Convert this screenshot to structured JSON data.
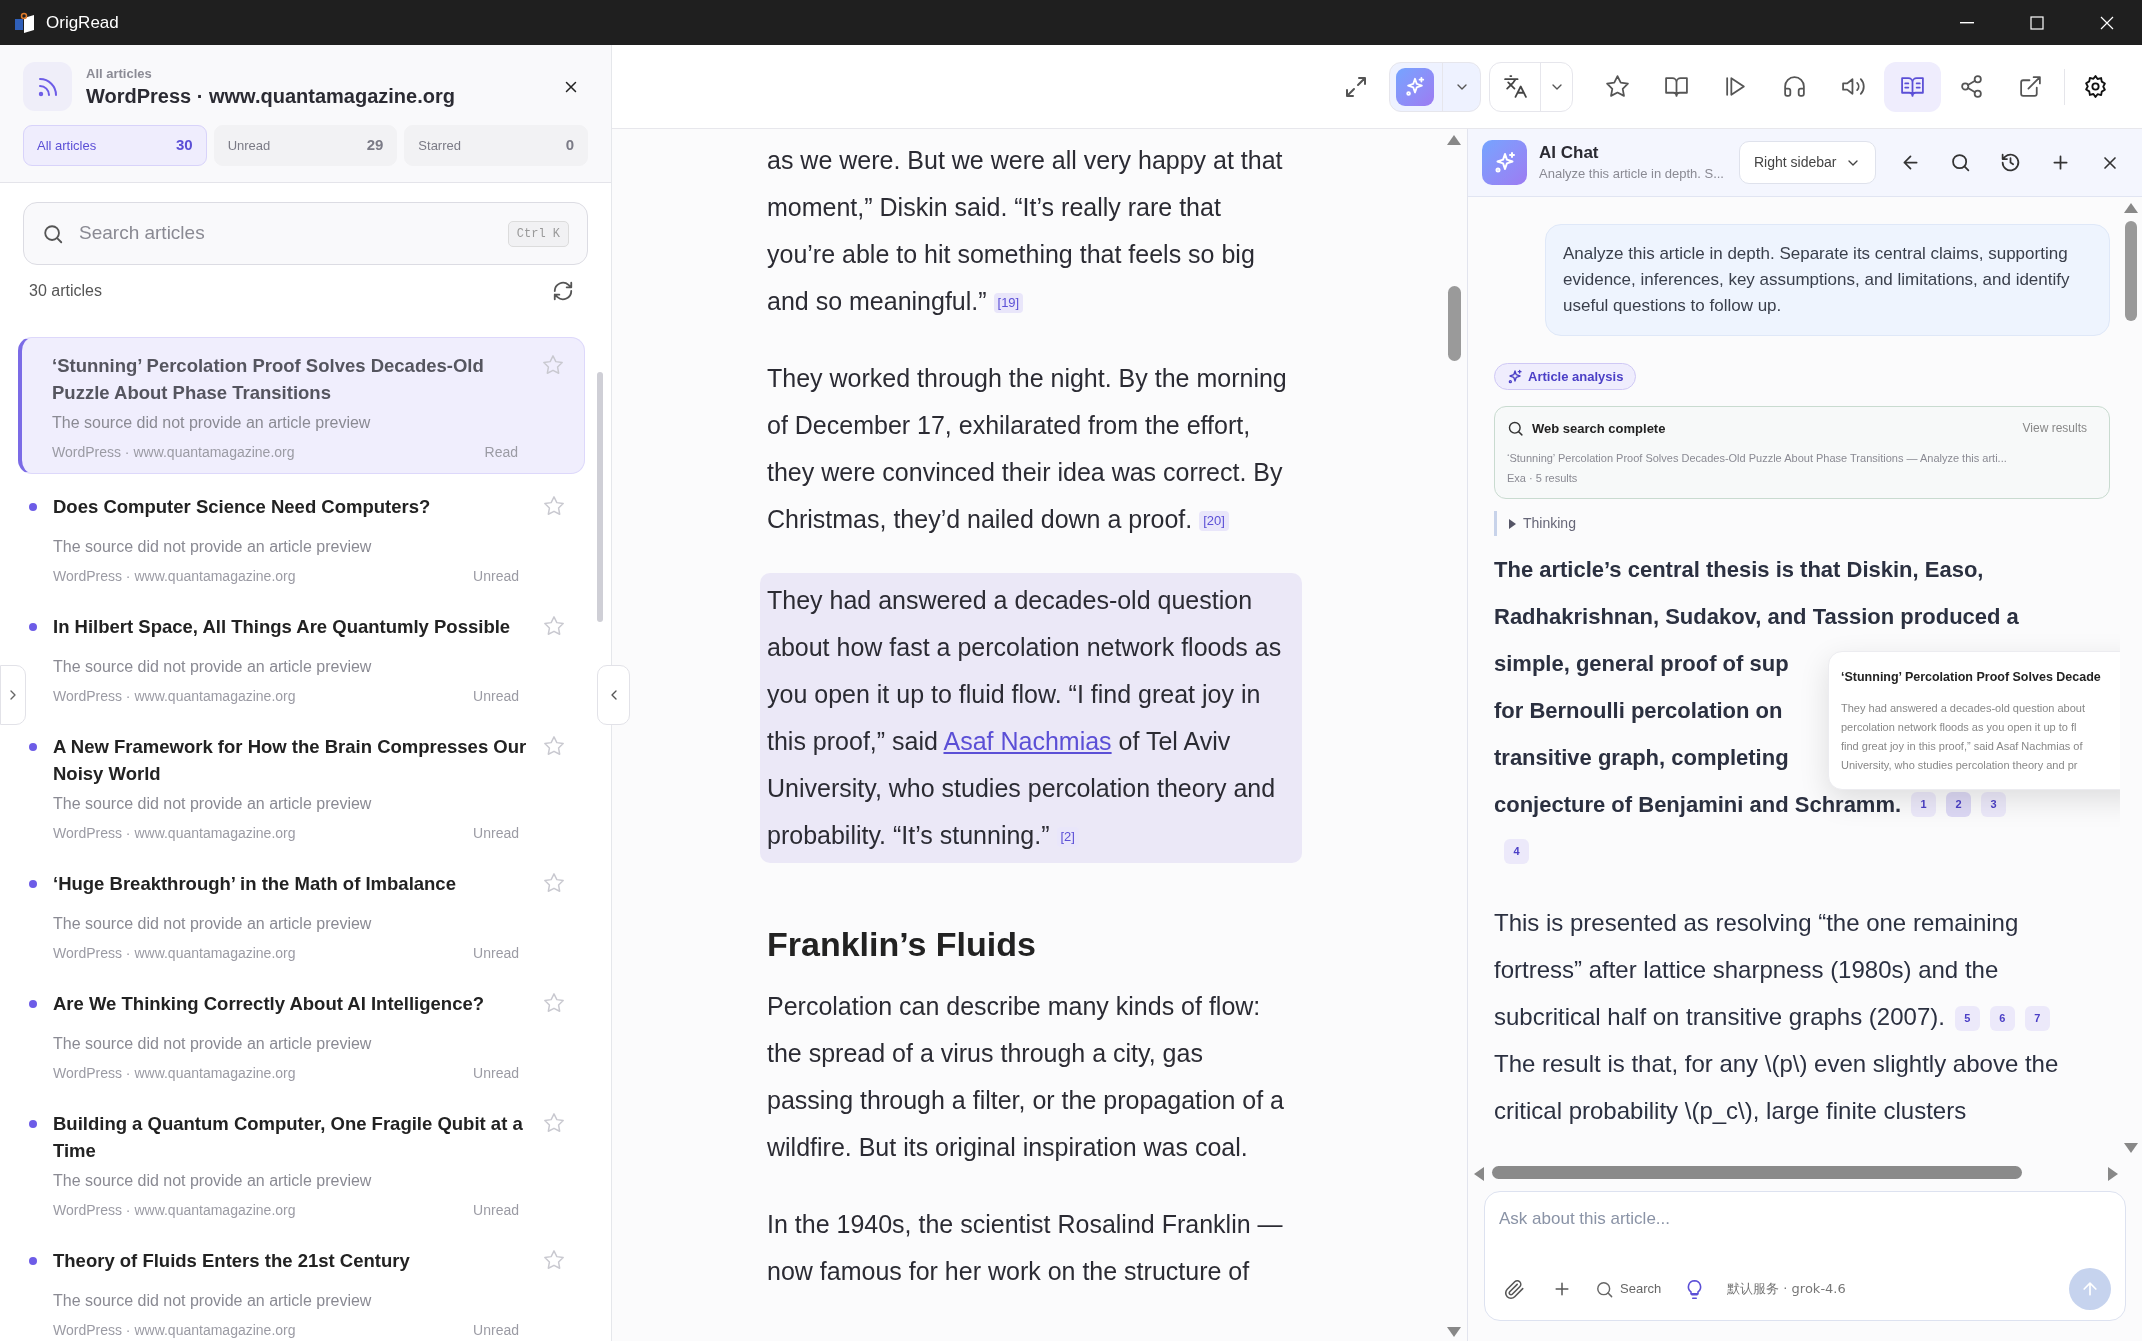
{
  "window": {
    "title": "OrigRead"
  },
  "sidebar": {
    "eyebrow": "All articles",
    "title": "WordPress · www.quantamagazine.org",
    "tabs": [
      {
        "label": "All articles",
        "count": "30",
        "selected": true
      },
      {
        "label": "Unread",
        "count": "29",
        "selected": false
      },
      {
        "label": "Starred",
        "count": "0",
        "selected": false
      }
    ],
    "search": {
      "placeholder": "Search articles",
      "shortcut": "Ctrl K"
    },
    "count_label": "30 articles",
    "articles": [
      {
        "title": "‘Stunning’ Percolation Proof Solves Decades-Old Puzzle About Phase Transitions",
        "preview": "The source did not provide an article preview",
        "source": "WordPress · www.quantamagazine.org",
        "status": "Read",
        "unread": false,
        "selected": true
      },
      {
        "title": "Does Computer Science Need Computers?",
        "preview": "The source did not provide an article preview",
        "source": "WordPress · www.quantamagazine.org",
        "status": "Unread",
        "unread": true,
        "selected": false
      },
      {
        "title": "In Hilbert Space, All Things Are Quantumly Possible",
        "preview": "The source did not provide an article preview",
        "source": "WordPress · www.quantamagazine.org",
        "status": "Unread",
        "unread": true,
        "selected": false
      },
      {
        "title": "A New Framework for How the Brain Compresses Our Noisy World",
        "preview": "The source did not provide an article preview",
        "source": "WordPress · www.quantamagazine.org",
        "status": "Unread",
        "unread": true,
        "selected": false
      },
      {
        "title": "‘Huge Breakthrough’ in the Math of Imbalance",
        "preview": "The source did not provide an article preview",
        "source": "WordPress · www.quantamagazine.org",
        "status": "Unread",
        "unread": true,
        "selected": false
      },
      {
        "title": "Are We Thinking Correctly About AI Intelligence?",
        "preview": "The source did not provide an article preview",
        "source": "WordPress · www.quantamagazine.org",
        "status": "Unread",
        "unread": true,
        "selected": false
      },
      {
        "title": "Building a Quantum Computer, One Fragile Qubit at a Time",
        "preview": "The source did not provide an article preview",
        "source": "WordPress · www.quantamagazine.org",
        "status": "Unread",
        "unread": true,
        "selected": false
      },
      {
        "title": "Theory of Fluids Enters the 21st Century",
        "preview": "The source did not provide an article preview",
        "source": "WordPress · www.quantamagazine.org",
        "status": "Unread",
        "unread": true,
        "selected": false
      }
    ]
  },
  "toolbar": [
    {
      "kind": "expand",
      "selected": false
    },
    {
      "kind": "ai",
      "selected": true
    },
    {
      "kind": "translate",
      "selected": false
    },
    {
      "kind": "star",
      "selected": false
    },
    {
      "kind": "book",
      "selected": false
    },
    {
      "kind": "play",
      "selected": false
    },
    {
      "kind": "listen",
      "selected": false
    },
    {
      "kind": "speak",
      "selected": false
    },
    {
      "kind": "reader",
      "selected": true
    },
    {
      "kind": "share",
      "selected": false
    },
    {
      "kind": "open",
      "selected": false
    },
    {
      "kind": "settings",
      "selected": false
    }
  ],
  "article": {
    "paragraphs": [
      {
        "kind": "p",
        "highlighted": false,
        "segments": [
          {
            "kind": "text",
            "text": "as we were. But we were all very happy at that moment,” Diskin said. “It’s really rare that you’re able to hit something that feels so big and so meaningful.”"
          }
        ],
        "citation": "[19]"
      },
      {
        "kind": "p",
        "highlighted": false,
        "segments": [
          {
            "kind": "text",
            "text": "They worked through the night. By the morning of December 17, exhilarated from the effort, they were convinced their idea was correct. By Christmas, they’d nailed down a proof."
          }
        ],
        "citation": "[20]"
      },
      {
        "kind": "p",
        "highlighted": true,
        "segments": [
          {
            "kind": "text",
            "text": "They had answered a decades-old question about how fast a percolation network floods as you open it up to fluid flow. “I find great joy in this proof,” said "
          },
          {
            "kind": "link",
            "text": "Asaf Nachmias"
          },
          {
            "kind": "text",
            "text": " of Tel Aviv University, who studies percolation theory and probability. “It’s stunning.”"
          }
        ],
        "citation": "[2]"
      },
      {
        "kind": "heading",
        "text": "Franklin’s Fluids"
      },
      {
        "kind": "p",
        "highlighted": false,
        "segments": [
          {
            "kind": "text",
            "text": "Percolation can describe many kinds of flow: the spread of a virus through a city, gas passing through a filter, or the propagation of a wildfire. But its original inspiration was coal."
          }
        ]
      },
      {
        "kind": "p",
        "highlighted": false,
        "segments": [
          {
            "kind": "text",
            "text": "In the 1940s, the scientist Rosalind Franklin — now famous for her work on the structure of"
          }
        ]
      }
    ]
  },
  "chat": {
    "title": "AI Chat",
    "subtitle": "Analyze this article in depth. S...",
    "placement": "Right sidebar",
    "user_message": "Analyze this article in depth. Separate its central claims, supporting evidence, inferences, key assumptions, and limitations, and identify useful questions to follow up.",
    "chip": "Article analysis",
    "web_search": {
      "title": "Web search complete",
      "action": "View results",
      "query": "‘Stunning’ Percolation Proof Solves Decades-Old Puzzle About Phase Transitions — Analyze this arti...",
      "meta": "Exa · 5 results"
    },
    "thinking": {
      "label": "Thinking",
      "expanded": false
    },
    "answer": [
      {
        "kind": "lines",
        "lines": [
          "The article’s central thesis is that Diskin, Easo,",
          "Radhakrishnan, Sudakov, and Tassion produced a",
          "simple, general proof of sup",
          "for Bernoulli percolation on",
          "transitive graph, completing",
          "conjecture of Benjamini and Schramm."
        ],
        "citations": [
          {
            "label": "1",
            "selected": false
          },
          {
            "label": "2",
            "selected": true
          },
          {
            "label": "3",
            "selected": false
          },
          {
            "label": "4",
            "selected": false
          }
        ]
      },
      {
        "kind": "text",
        "text": "This is presented as resolving “the one remaining fortress” after lattice sharpness (1980s) and the subcritical half on transitive graphs (2007).",
        "citations": [
          {
            "label": "5",
            "selected": false
          },
          {
            "label": "6",
            "selected": false
          },
          {
            "label": "7",
            "selected": false
          }
        ]
      },
      {
        "kind": "text",
        "text": "The result is that, for any \\(p\\) even slightly above the critical probability \\(p_c\\), large finite clusters"
      }
    ],
    "popover": {
      "title": "‘Stunning’ Percolation Proof Solves Decade",
      "lines": [
        "They had answered a decades-old question about",
        "percolation network floods as you open it up to fl",
        "find great joy in this proof,” said Asaf Nachmias of",
        "University, who studies percolation theory and pr"
      ]
    },
    "composer": {
      "placeholder": "Ask about this article...",
      "search_label": "Search",
      "model": "默认服务 · grok-4.6",
      "send_enabled": false
    }
  }
}
